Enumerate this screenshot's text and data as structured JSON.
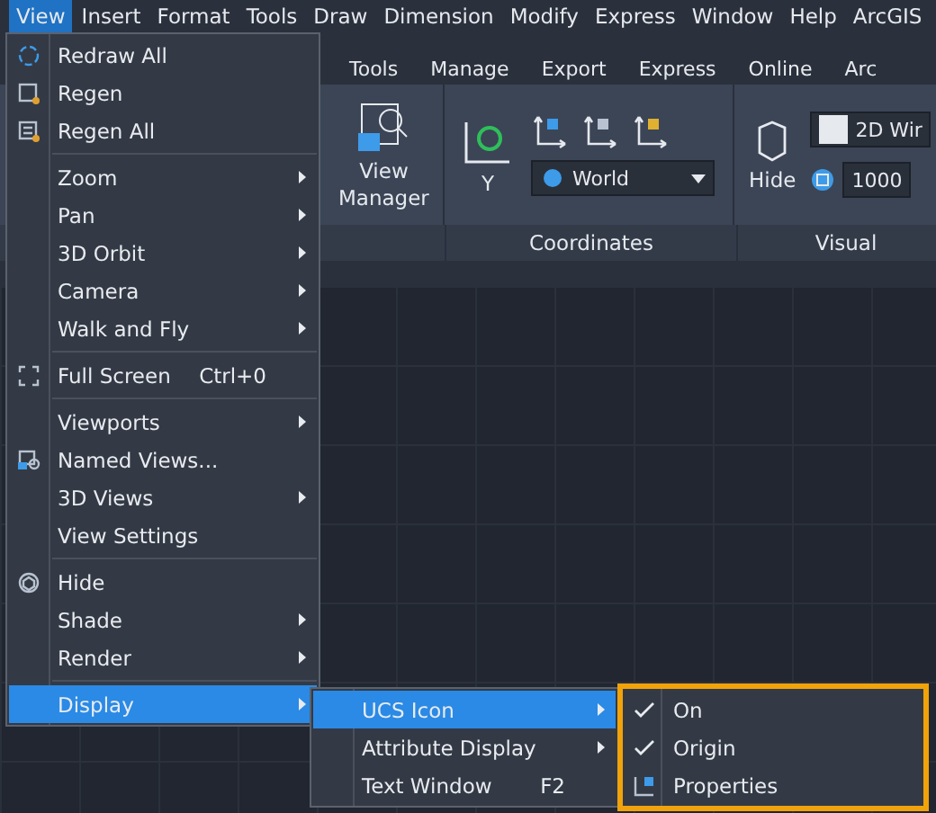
{
  "menubar": [
    {
      "label": "View",
      "selected": true
    },
    {
      "label": "Insert",
      "selected": false
    },
    {
      "label": "Format",
      "selected": false
    },
    {
      "label": "Tools",
      "selected": false
    },
    {
      "label": "Draw",
      "selected": false
    },
    {
      "label": "Dimension",
      "selected": false
    },
    {
      "label": "Modify",
      "selected": false
    },
    {
      "label": "Express",
      "selected": false
    },
    {
      "label": "Window",
      "selected": false
    },
    {
      "label": "Help",
      "selected": false
    },
    {
      "label": "ArcGIS",
      "selected": false
    }
  ],
  "ribbon": {
    "tabs": [
      "Tools",
      "Manage",
      "Export",
      "Express",
      "Online",
      "Arc"
    ],
    "view_manager": "View Manager",
    "coordinates": {
      "ucs_button": "Y",
      "ucs_combo": "World",
      "title": "Coordinates"
    },
    "visual": {
      "hide": "Hide",
      "style_combo": "2D Wir",
      "value": "1000",
      "title": "Visual"
    }
  },
  "menu": [
    {
      "kind": "item",
      "label": "Redraw All",
      "submenu": false,
      "selected": false
    },
    {
      "kind": "item",
      "label": "Regen",
      "submenu": false,
      "selected": false
    },
    {
      "kind": "item",
      "label": "Regen All",
      "submenu": false,
      "selected": false
    },
    {
      "kind": "separator"
    },
    {
      "kind": "item",
      "label": "Zoom",
      "submenu": true,
      "selected": false
    },
    {
      "kind": "item",
      "label": "Pan",
      "submenu": true,
      "selected": false
    },
    {
      "kind": "item",
      "label": "3D Orbit",
      "submenu": true,
      "selected": false
    },
    {
      "kind": "item",
      "label": "Camera",
      "submenu": true,
      "selected": false
    },
    {
      "kind": "item",
      "label": "Walk and Fly",
      "submenu": true,
      "selected": false
    },
    {
      "kind": "separator"
    },
    {
      "kind": "item",
      "label": "Full Screen",
      "shortcut": "Ctrl+0",
      "submenu": false,
      "selected": false
    },
    {
      "kind": "separator"
    },
    {
      "kind": "item",
      "label": "Viewports",
      "submenu": true,
      "selected": false
    },
    {
      "kind": "item",
      "label": "Named Views...",
      "submenu": false,
      "selected": false
    },
    {
      "kind": "item",
      "label": "3D Views",
      "submenu": true,
      "selected": false
    },
    {
      "kind": "item",
      "label": "View Settings",
      "submenu": false,
      "selected": false
    },
    {
      "kind": "separator"
    },
    {
      "kind": "item",
      "label": "Hide",
      "submenu": false,
      "selected": false
    },
    {
      "kind": "item",
      "label": "Shade",
      "submenu": true,
      "selected": false
    },
    {
      "kind": "item",
      "label": "Render",
      "submenu": true,
      "selected": false
    },
    {
      "kind": "separator"
    },
    {
      "kind": "item",
      "label": "Display",
      "submenu": true,
      "selected": true
    }
  ],
  "display_menu": [
    {
      "label": "UCS Icon",
      "submenu": true,
      "selected": true
    },
    {
      "label": "Attribute Display",
      "submenu": true,
      "selected": false
    },
    {
      "label": "Text Window",
      "shortcut": "F2",
      "submenu": false,
      "selected": false
    }
  ],
  "ucs_icon_menu": [
    {
      "label": "On",
      "checked": true
    },
    {
      "label": "Origin",
      "checked": true
    },
    {
      "label": "Properties",
      "checked": false
    }
  ]
}
